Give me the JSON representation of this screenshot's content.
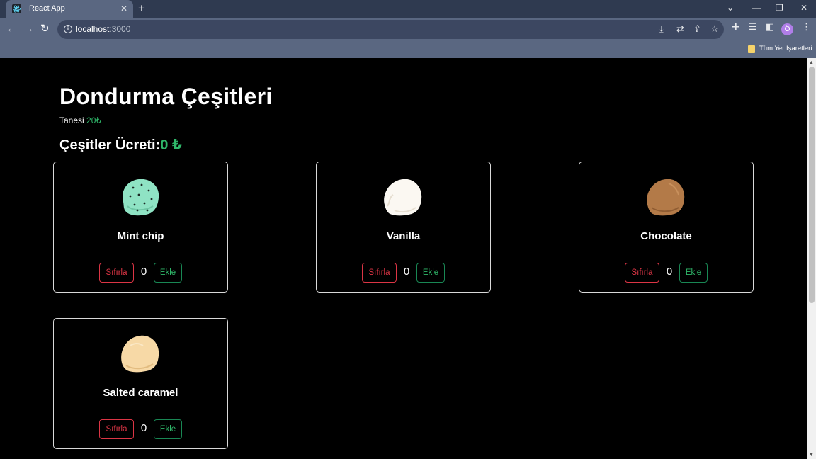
{
  "browser": {
    "tab_title": "React App",
    "url_host": "localhost",
    "url_port": ":3000",
    "avatar_letter": "Ö",
    "bookmarks_label": "Tüm Yer İşaretleri"
  },
  "header": {
    "title": "Dondurma Çeşitleri",
    "unit_label": "Tanesi",
    "unit_price": "20₺",
    "total_label": "Çeşitler Ücreti:",
    "total_value": "0 ₺"
  },
  "buttons": {
    "reset_label": "Sıfırla",
    "add_label": "Ekle"
  },
  "colors": {
    "accent_green": "#2fb86a",
    "reset_red": "#dc3545",
    "background": "#000000"
  },
  "flavors": [
    {
      "name": "Mint chip",
      "count": "0",
      "color": "#8fe3c4"
    },
    {
      "name": "Vanilla",
      "count": "0",
      "color": "#fbf8f2"
    },
    {
      "name": "Chocolate",
      "count": "0",
      "color": "#b37a48"
    },
    {
      "name": "Salted caramel",
      "count": "0",
      "color": "#f7d9a6"
    }
  ]
}
